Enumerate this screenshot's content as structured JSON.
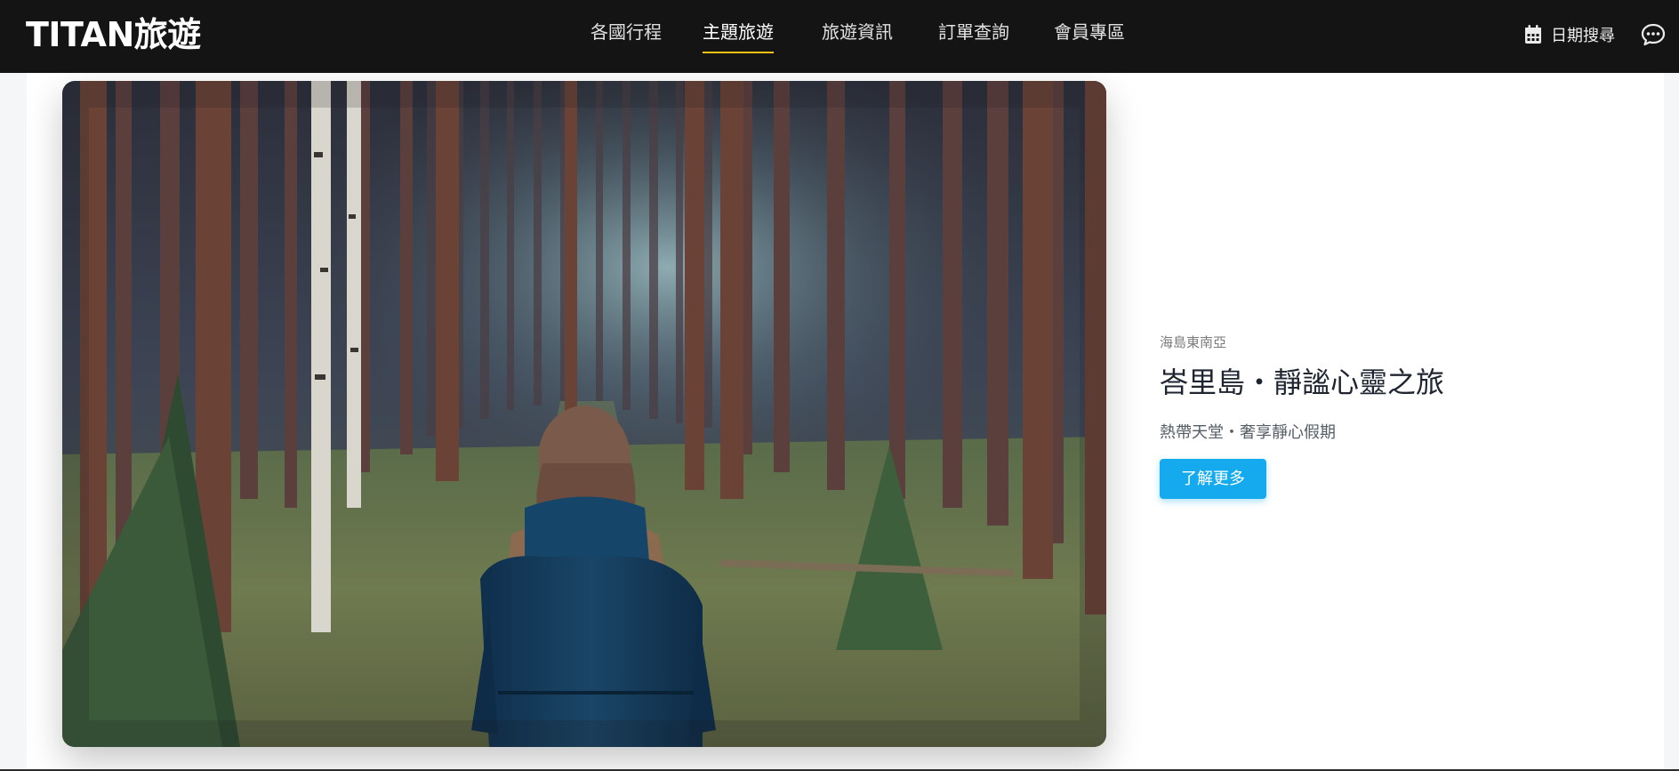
{
  "brand": {
    "logo": "TITAN旅遊"
  },
  "nav": {
    "items": [
      {
        "label": "各國行程"
      },
      {
        "label": "主題旅遊",
        "active": true
      },
      {
        "label": "旅遊資訊"
      },
      {
        "label": "訂單查詢"
      },
      {
        "label": "會員專區"
      }
    ],
    "active_color": "#f5c211"
  },
  "header_actions": {
    "date_search": {
      "label": "日期搜尋",
      "icon": "calendar-icon"
    },
    "chat": {
      "icon": "chat-icon"
    }
  },
  "feature": {
    "category": "海島東南亞",
    "title": "峇里島・靜謐心靈之旅",
    "subtitle": "熱帶天堂・奢享靜心假期",
    "cta_label": "了解更多",
    "cta_color": "#15aaee",
    "image": {
      "subject": "woman-in-forest-photo"
    }
  }
}
